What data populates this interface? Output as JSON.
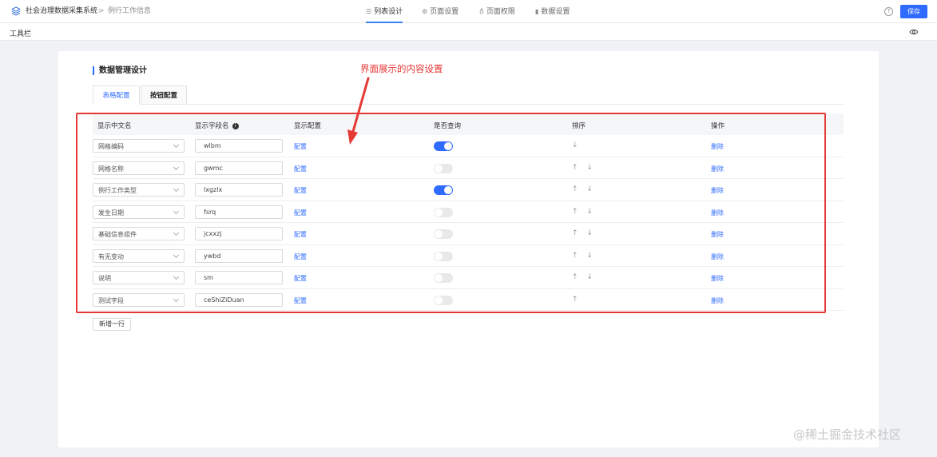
{
  "header": {
    "system_name": "社会治理数据采集系统",
    "separator": ">",
    "page_name": "例行工作信息",
    "nav_tabs": [
      {
        "label": "列表设计",
        "icon": "list-icon",
        "active": true
      },
      {
        "label": "页面设置",
        "icon": "gear-icon",
        "active": false
      },
      {
        "label": "页面权限",
        "icon": "lock-icon",
        "active": false
      },
      {
        "label": "数据设置",
        "icon": "bar-chart-icon",
        "active": false
      }
    ],
    "help": "?",
    "save_label": "保存"
  },
  "toolbar": {
    "label": "工具栏"
  },
  "card": {
    "title": "数据管理设计",
    "tabs": [
      {
        "label": "表格配置",
        "active": true
      },
      {
        "label": "按钮配置",
        "active": false
      }
    ]
  },
  "table": {
    "headers": {
      "cn_name": "显示中文名",
      "field_name": "显示字段名",
      "config": "显示配置",
      "query": "是否查询",
      "sort": "排序",
      "action": "操作"
    },
    "rows": [
      {
        "cn_name": "网格编码",
        "field": "wlbm",
        "config": "配置",
        "query": true,
        "sort": "↓",
        "action": "删除"
      },
      {
        "cn_name": "网格名称",
        "field": "gwmc",
        "config": "配置",
        "query": false,
        "sort": "↑ ↓",
        "action": "删除"
      },
      {
        "cn_name": "例行工作类型",
        "field": "lxgzlx",
        "config": "配置",
        "query": true,
        "sort": "↑ ↓",
        "action": "删除"
      },
      {
        "cn_name": "发生日期",
        "field": "fsrq",
        "config": "配置",
        "query": false,
        "sort": "↑ ↓",
        "action": "删除"
      },
      {
        "cn_name": "基础信息组件",
        "field": "jcxxzj",
        "config": "配置",
        "query": false,
        "sort": "↑ ↓",
        "action": "删除"
      },
      {
        "cn_name": "有无变动",
        "field": "ywbd",
        "config": "配置",
        "query": false,
        "sort": "↑ ↓",
        "action": "删除"
      },
      {
        "cn_name": "说明",
        "field": "sm",
        "config": "配置",
        "query": false,
        "sort": "↑ ↓",
        "action": "删除"
      },
      {
        "cn_name": "测试字段",
        "field": "ceShiZiDuan",
        "config": "配置",
        "query": false,
        "sort": "↑",
        "action": "删除"
      }
    ],
    "add_row_label": "新增一行"
  },
  "annotation": {
    "text": "界面展示的内容设置",
    "color": "#e53935"
  },
  "watermark": "@稀土掘金技术社区",
  "colors": {
    "accent": "#2f6bff",
    "annotation": "#e53935"
  }
}
